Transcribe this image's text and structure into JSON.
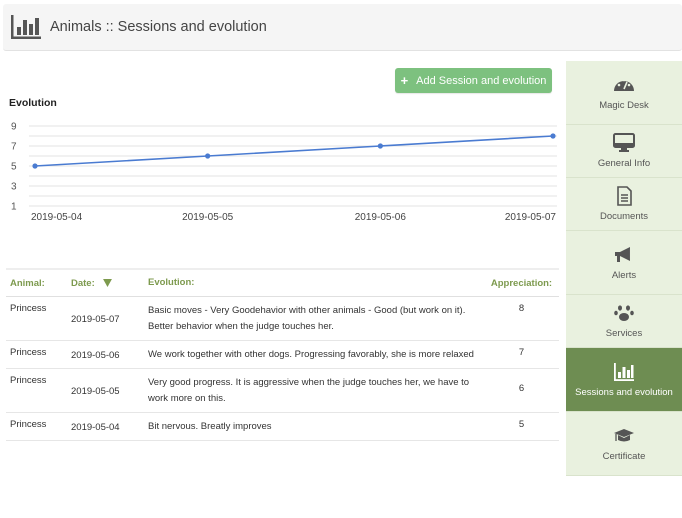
{
  "header": {
    "title": "Animals :: Sessions and evolution",
    "icon": "bar-chart-icon"
  },
  "toolbar": {
    "add_label": "Add Session and evolution",
    "add_icon": "plus-icon"
  },
  "colors": {
    "accent_green": "#7dc17f",
    "active_nav": "#6e8d52",
    "nav_bg": "#e9f1df",
    "line": "#4a7bd1",
    "table_header": "#7d9a4e"
  },
  "chart_data": {
    "type": "line",
    "title": "Evolution",
    "xlabel": "",
    "ylabel": "",
    "categories": [
      "2019-05-04",
      "2019-05-05",
      "2019-05-06",
      "2019-05-07"
    ],
    "series": [
      {
        "name": "Appreciation",
        "values": [
          5,
          6,
          7,
          8
        ]
      }
    ],
    "yticks": [
      1,
      3,
      5,
      7,
      9
    ],
    "ylim": [
      1,
      9
    ],
    "grid": true,
    "legend": "none"
  },
  "table": {
    "columns": [
      "Animal:",
      "Date:",
      "Evolution:",
      "Appreciation:"
    ],
    "sort_icon": "sort-desc-icon",
    "rows": [
      {
        "animal": "Princess",
        "date": "2019-05-07",
        "evolution": "Basic moves - Very Goodehavior with other animals - Good (but work on it). Better behavior when the judge touches her.",
        "appreciation": "8"
      },
      {
        "animal": "Princess",
        "date": "2019-05-06",
        "evolution": "We work together with other dogs. Progressing favorably, she is more relaxed",
        "appreciation": "7"
      },
      {
        "animal": "Princess",
        "date": "2019-05-05",
        "evolution": "Very good progress. It is aggressive when the judge touches her, we have to work more on this.",
        "appreciation": "6"
      },
      {
        "animal": "Princess",
        "date": "2019-05-04",
        "evolution": "Bit nervous. Breatly improves",
        "appreciation": "5"
      }
    ]
  },
  "sidebar": {
    "items": [
      {
        "label": "Magic Desk",
        "icon": "dashboard-icon",
        "active": false
      },
      {
        "label": "General Info",
        "icon": "monitor-icon",
        "active": false
      },
      {
        "label": "Documents",
        "icon": "document-icon",
        "active": false
      },
      {
        "label": "Alerts",
        "icon": "megaphone-icon",
        "active": false
      },
      {
        "label": "Services",
        "icon": "paw-icon",
        "active": false
      },
      {
        "label": "Sessions and evolution",
        "icon": "bar-chart-icon",
        "active": true
      },
      {
        "label": "Certificate",
        "icon": "graduation-cap-icon",
        "active": false
      }
    ]
  }
}
